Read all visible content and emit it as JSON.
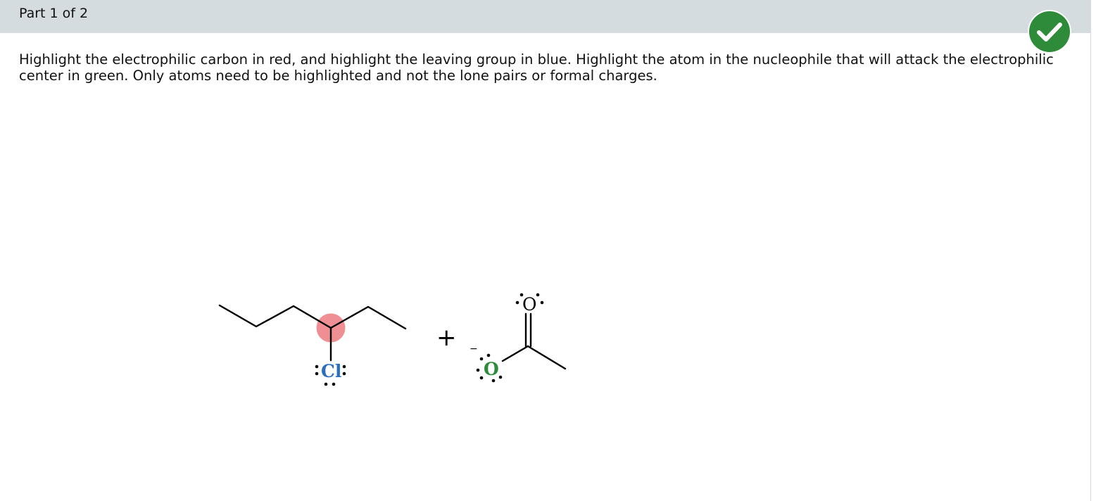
{
  "header": {
    "part_label": "Part 1 of 2"
  },
  "status": {
    "icon": "checkmark-icon",
    "state": "correct",
    "color": "#2e8b3a"
  },
  "question": {
    "instructions": "Highlight the electrophilic carbon in red, and highlight the leaving group in blue. Highlight the atom in the nucleophile that will attack the electrophilic center in green. Only atoms need to be highlighted and not the lone pairs or formal charges."
  },
  "reaction": {
    "plus_sign": "+",
    "substrate": {
      "leaving_group_symbol": "Cl",
      "leaving_group_color": "#2a6fbd",
      "electrophilic_carbon_highlight": "#ef8f93"
    },
    "nucleophile": {
      "attacking_atom_symbol": "O",
      "attacking_atom_color": "#2e8b3a",
      "formal_charge": "−",
      "carbonyl_oxygen_symbol": "O"
    }
  }
}
